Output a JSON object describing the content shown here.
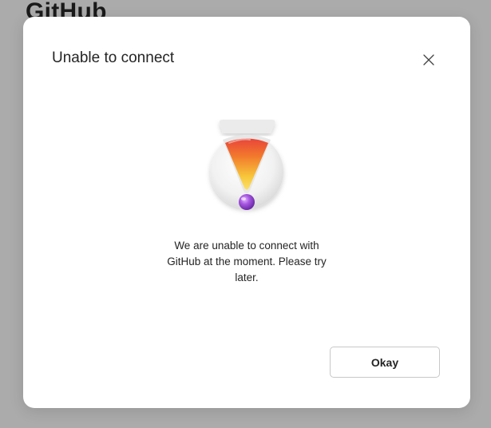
{
  "background": {
    "title": "GitHub"
  },
  "dialog": {
    "title": "Unable to connect",
    "message": "We are unable to connect with GitHub at the moment. Please try later.",
    "okay_label": "Okay",
    "close_icon": "close-icon",
    "illustration_icon": "warning-exclamation-icon"
  },
  "colors": {
    "overlay": "#ababab",
    "dialog_bg": "#ffffff",
    "text": "#242424",
    "accent_orange": "#f0772a",
    "accent_yellow": "#f7c435",
    "accent_purple": "#9b45d6"
  }
}
